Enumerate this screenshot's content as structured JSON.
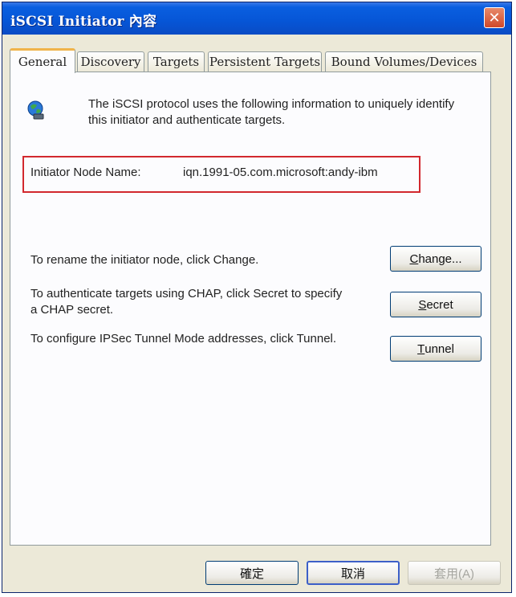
{
  "window": {
    "title": "iSCSI Initiator 內容",
    "close_label": "✕"
  },
  "tabs": [
    {
      "label": "General"
    },
    {
      "label": "Discovery"
    },
    {
      "label": "Targets"
    },
    {
      "label": "Persistent Targets"
    },
    {
      "label": "Bound Volumes/Devices"
    }
  ],
  "active_tab": "General",
  "general": {
    "intro_text": "The iSCSI protocol uses the following information to uniquely identify this initiator and authenticate targets.",
    "node_name_label": "Initiator Node Name:",
    "node_name_value": "iqn.1991-05.com.microsoft:andy-ibm",
    "rename_text": "To rename the initiator node, click Change.",
    "chap_text": "To authenticate targets using CHAP, click Secret to specify a CHAP secret.",
    "ipsec_text": "To configure IPSec Tunnel Mode addresses, click Tunnel.",
    "change_button": {
      "hotkey": "C",
      "rest": "hange..."
    },
    "secret_button": {
      "hotkey": "S",
      "rest": "ecret"
    },
    "tunnel_button": {
      "hotkey": "T",
      "rest": "unnel"
    }
  },
  "footer": {
    "ok_label": "確定",
    "cancel_label": "取消",
    "apply_label": "套用(A)"
  },
  "colors": {
    "title_bar": "#0a5fe0",
    "highlight_box": "#d2282e",
    "dialog_bg": "#ece9d8"
  }
}
